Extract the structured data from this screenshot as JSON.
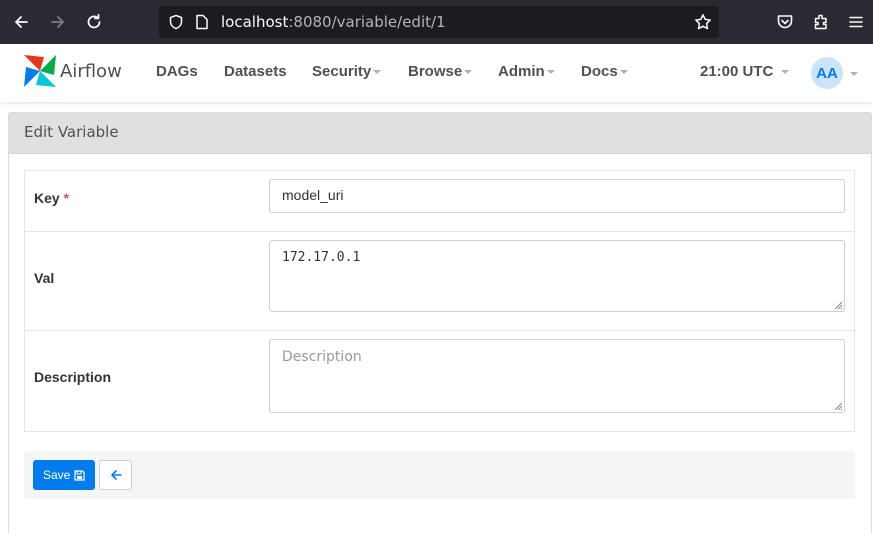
{
  "browser": {
    "url_host": "localhost",
    "url_rest": ":8080/variable/edit/1",
    "icons": [
      "back-arrow-icon",
      "forward-arrow-icon",
      "reload-icon",
      "shield-icon",
      "page-icon",
      "bookmark-star-icon",
      "pocket-icon",
      "extensions-icon",
      "menu-icon"
    ]
  },
  "navbar": {
    "brand": "Airflow",
    "items": [
      {
        "label": "DAGs",
        "dropdown": false
      },
      {
        "label": "Datasets",
        "dropdown": false
      },
      {
        "label": "Security",
        "dropdown": true
      },
      {
        "label": "Browse",
        "dropdown": true
      },
      {
        "label": "Admin",
        "dropdown": true
      },
      {
        "label": "Docs",
        "dropdown": true
      }
    ],
    "clock": "21:00 UTC",
    "avatar": "AA"
  },
  "panel": {
    "title": "Edit Variable"
  },
  "form": {
    "key_label": "Key",
    "required_mark": "*",
    "key_value": "model_uri",
    "val_label": "Val",
    "val_value": "172.17.0.1",
    "description_label": "Description",
    "description_placeholder": "Description",
    "description_value": ""
  },
  "actions": {
    "save_label": "Save"
  },
  "colors": {
    "accent": "#017cee",
    "chrome": "#2b2a33",
    "required": "#d9534f"
  }
}
